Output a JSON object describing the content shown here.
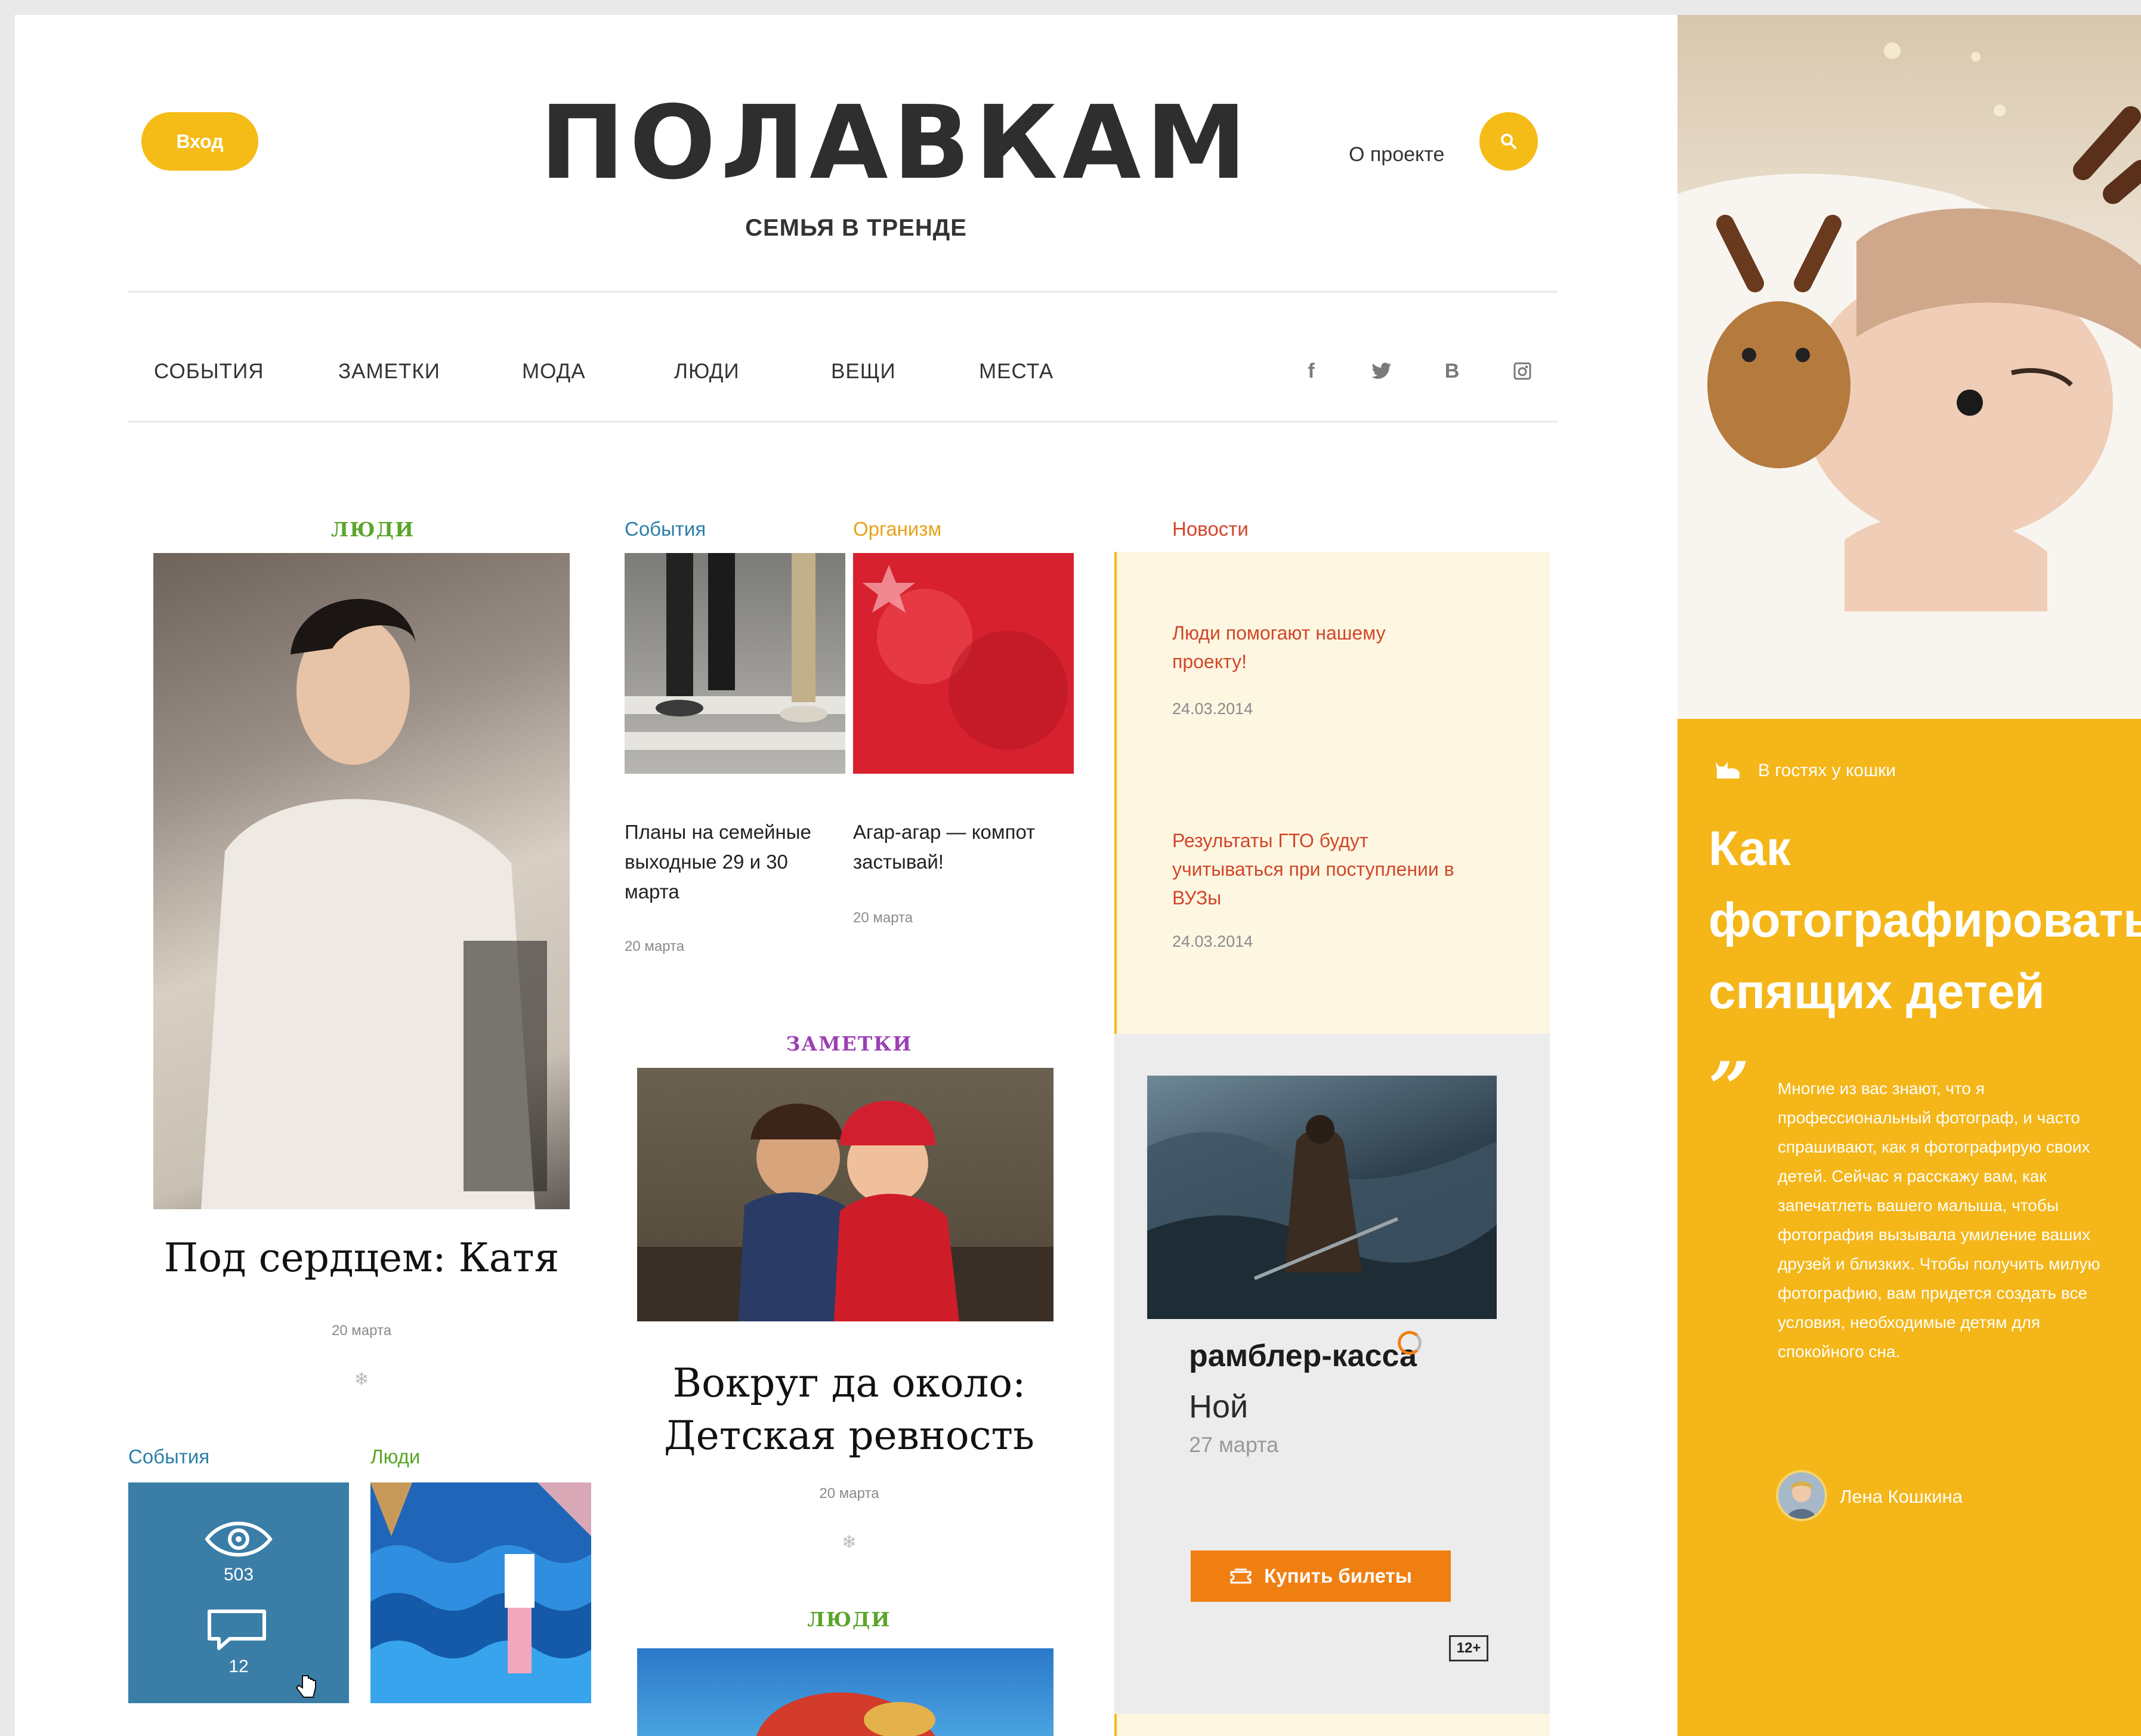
{
  "header": {
    "login_label": "Вход",
    "logo": "ПОЛАВКАМ",
    "tagline": "СЕМЬЯ В ТРЕНДЕ",
    "about_label": "О проекте"
  },
  "nav": {
    "items": [
      "СОБЫТИЯ",
      "ЗАМЕТКИ",
      "МОДА",
      "ЛЮДИ",
      "ВЕЩИ",
      "МЕСТА"
    ],
    "social": [
      "f",
      "t",
      "В",
      "i"
    ]
  },
  "col1": {
    "label": "ЛЮДИ",
    "title": "Под сердцем: Катя",
    "date": "20 марта",
    "events_label": "События",
    "people_label": "Люди",
    "views": "503",
    "comments": "12"
  },
  "col2": {
    "card1": {
      "label": "События",
      "title": "Планы на семейные выходные 29 и 30 марта",
      "date": "20 марта"
    },
    "card2": {
      "label": "Организм",
      "title": "Агар-агар — компот застывай!",
      "date": "20 марта"
    },
    "notes_label": "ЗАМЕТКИ",
    "feature_title": "Вокруг да около: Детская ревность",
    "feature_date": "20 марта",
    "people_label": "ЛЮДИ"
  },
  "news": {
    "label": "Новости",
    "items": [
      {
        "title": "Люди помогают нашему проекту!",
        "date": "24.03.2014"
      },
      {
        "title": "Результаты ГТО будут учитываться при поступлении в ВУЗы",
        "date": "24.03.2014"
      }
    ]
  },
  "rambler": {
    "logo": "рамблер-касса",
    "movie": "Ной",
    "date": "27 марта",
    "buy_label": "Купить билеты",
    "age": "12+"
  },
  "sidebar": {
    "category": "В гостях у кошки",
    "title": "Как фотографировать спящих детей",
    "text": "Многие из вас знают, что я профессиональный фотограф, и часто спрашивают, как я фотографирую своих детей. Сейчас я расскажу вам, как запечатлеть вашего малыша, чтобы фотография вызывала умиление ваших друзей и близких. Чтобы получить милую фотографию, вам придется создать все условия, необходимые детям для спокойного сна.",
    "author": "Лена Кошкина"
  },
  "colors": {
    "accent": "#f5bb17",
    "people": "#5aa52a",
    "events": "#2c7fa8",
    "organism": "#e8a31a",
    "news": "#d2462a",
    "notes": "#9b3fb5"
  }
}
